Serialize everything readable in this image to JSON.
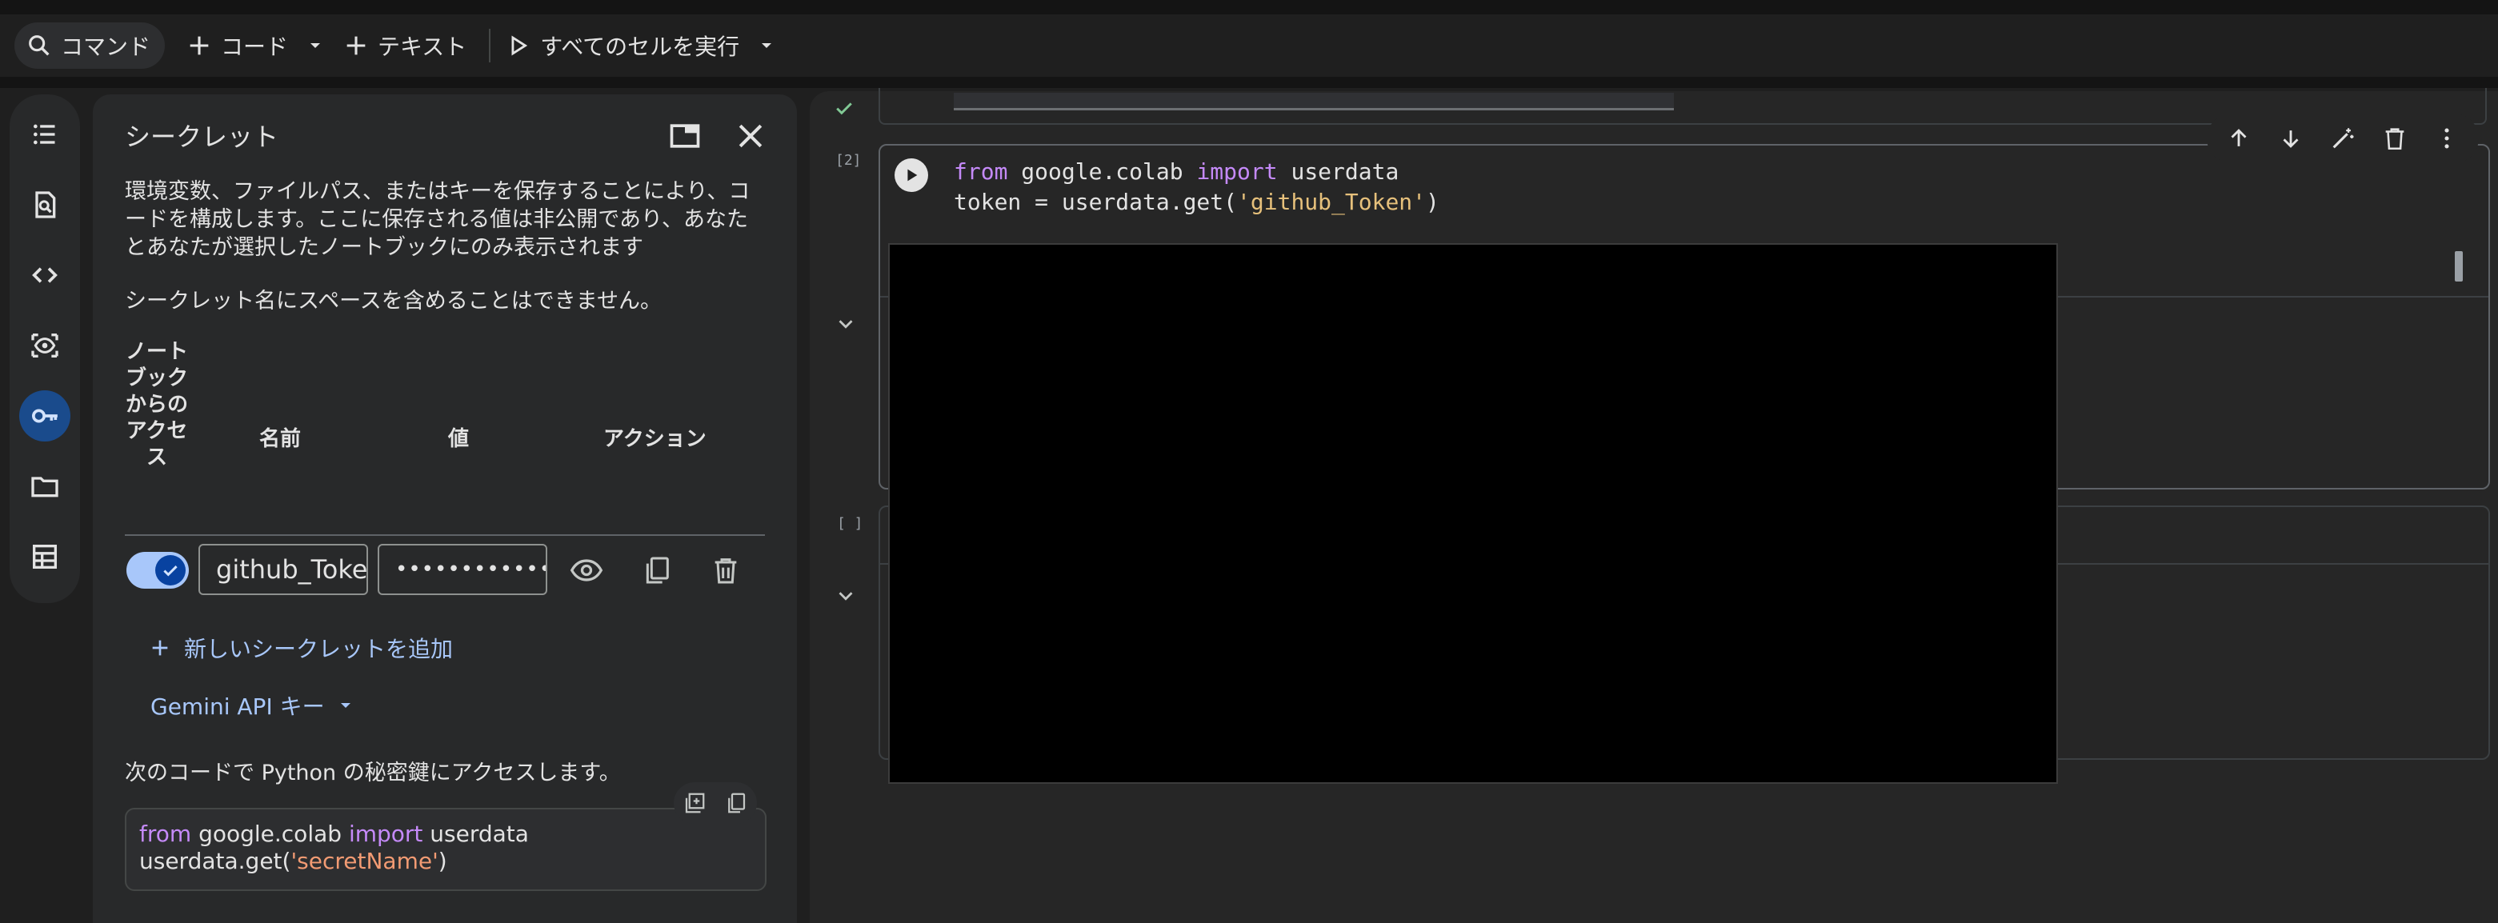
{
  "toolbar": {
    "command_label": "コマンド",
    "code_label": "コード",
    "text_label": "テキスト",
    "run_all_label": "すべてのセルを実行"
  },
  "rail": {
    "items": [
      "toc-icon",
      "search-icon",
      "code-snippets-icon",
      "variables-icon",
      "secrets-key-icon",
      "files-icon",
      "data-table-icon"
    ],
    "active": "secrets-key-icon"
  },
  "secrets": {
    "title": "シークレット",
    "description": "環境変数、ファイルパス、またはキーを保存することにより、コードを構成します。ここに保存される値は非公開であり、あなたとあなたが選択したノートブックにのみ表示されます",
    "note": "シークレット名にスペースを含めることはできません。",
    "headers": {
      "access": "ノートブックからのアクセス",
      "name": "名前",
      "value": "値",
      "action": "アクション"
    },
    "rows": [
      {
        "access_enabled": true,
        "name": "github_Toke",
        "value": "••••••••••••"
      }
    ],
    "add_label": "新しいシークレットを追加",
    "gemini_label": "Gemini API キー",
    "access_text": "次のコードで Python の秘密鍵にアクセスします。",
    "snippet": {
      "line1_kw1": "from",
      "line1_mod": " google.colab ",
      "line1_kw2": "import",
      "line1_name": " userdata",
      "line2_pre": "userdata.get(",
      "line2_str": "'secretName'",
      "line2_post": ")"
    }
  },
  "notebook": {
    "cell1": {
      "exec_count": "[2]",
      "line1_kw1": "from",
      "line1_mod": " google.colab ",
      "line1_kw2": "import",
      "line1_name": " userdata",
      "line2_pre": "token = userdata.get(",
      "line2_str": "'github_Token'",
      "line2_post": ")"
    },
    "cell2": {
      "exec_count": "[ ]"
    }
  },
  "colors": {
    "accent": "#a8c7fa",
    "keyword": "#c58af9",
    "string": "#e6c07b",
    "background": "#1f1f1f"
  }
}
